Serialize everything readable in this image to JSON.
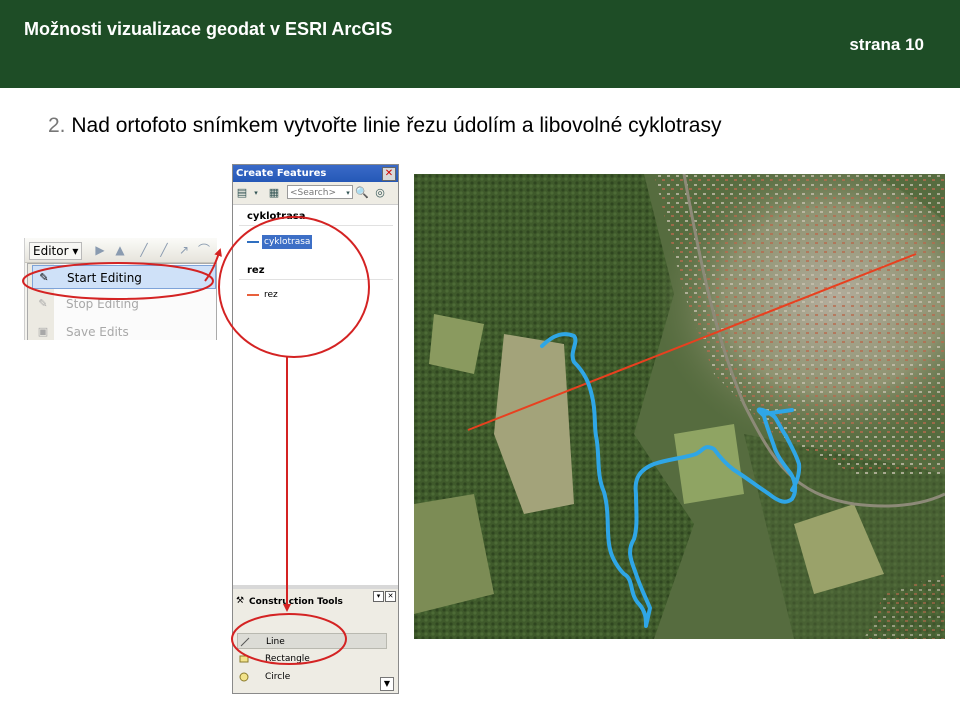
{
  "header": {
    "title": "Možnosti vizualizace geodat v ESRI ArcGIS",
    "page_label": "strana 10"
  },
  "task": {
    "number": "2.",
    "text": "Nad ortofoto snímkem vytvořte linie řezu údolím a libovolné cyklotrasy"
  },
  "editor_toolbar": {
    "menu_label": "Editor ▾",
    "items": [
      {
        "label": "Start Editing",
        "state": "highlighted"
      },
      {
        "label": "Stop Editing",
        "state": "disabled"
      },
      {
        "label": "Save Edits",
        "state": "disabled"
      }
    ]
  },
  "create_features": {
    "title": "Create Features",
    "search_placeholder": "<Search>",
    "groups": [
      {
        "name": "cyklotrasa",
        "template": "cyklotrasa",
        "symbol_color": "#2f6fc0"
      },
      {
        "name": "rez",
        "template": "rez",
        "symbol_color": "#e8603c"
      }
    ],
    "construction_tools": {
      "header": "Construction Tools",
      "items": [
        "Line",
        "Rectangle",
        "Circle"
      ]
    }
  },
  "colors": {
    "header_bg": "#1e4d26",
    "annotation_red": "#d42323",
    "bike_route": "#2fa6e6",
    "cross_section": "#e8401f"
  }
}
